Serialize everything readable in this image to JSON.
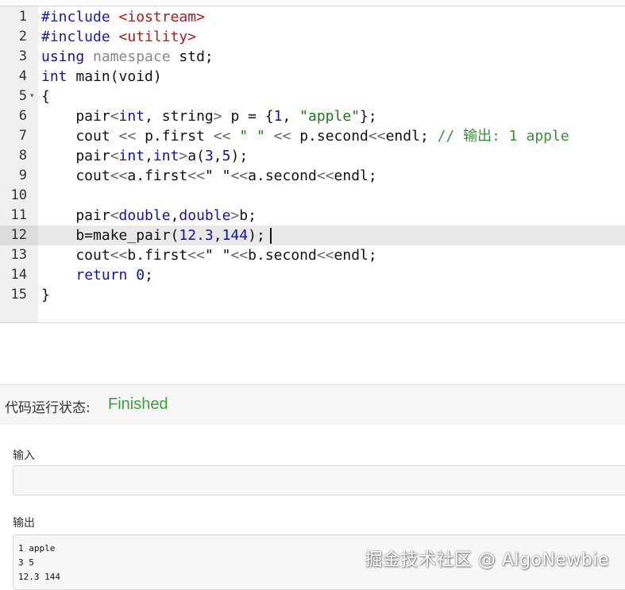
{
  "editor": {
    "line_numbers": [
      "1",
      "2",
      "3",
      "4",
      "5",
      "6",
      "7",
      "8",
      "9",
      "10",
      "11",
      "12",
      "13",
      "14",
      "15"
    ],
    "active_line": "12",
    "code": {
      "l1": {
        "a": "#include ",
        "b": "<iostream>"
      },
      "l2": {
        "a": "#include ",
        "b": "<utility>"
      },
      "l3": {
        "a": "using",
        "b": " ",
        "c": "namespace",
        "d": " std;"
      },
      "l4": {
        "a": "int",
        "b": " main(void)"
      },
      "l5": {
        "a": "{"
      },
      "l6": {
        "a": "    pair",
        "b": "<",
        "c": "int",
        "d": ", string",
        "e": ">",
        "f": " p = {",
        "g": "1",
        "h": ", ",
        "i": "\"apple\"",
        "j": "};"
      },
      "l7": {
        "a": "    cout ",
        "b": "<<",
        "c": " p.first ",
        "d": "<<",
        "e": " ",
        "f": "\" \"",
        "g": " ",
        "h": "<<",
        "i": " p.second",
        "j": "<<",
        "k": "endl; ",
        "l": "// 输出: 1 apple"
      },
      "l8": {
        "a": "    pair",
        "b": "<",
        "c": "int",
        "d": ",",
        "e": "int",
        "f": ">",
        "g": "a(",
        "h": "3",
        "i": ",",
        "j": "5",
        "k": ");"
      },
      "l9": {
        "a": "    cout",
        "b": "<<",
        "c": "a.first",
        "d": "<<",
        "e": "\" \"",
        "f": "<<",
        "g": "a.second",
        "h": "<<",
        "i": "endl;"
      },
      "l10": {
        "a": ""
      },
      "l11": {
        "a": "    pair",
        "b": "<",
        "c": "double",
        "d": ",",
        "e": "double",
        "f": ">",
        "g": "b;"
      },
      "l12": {
        "a": "    b=make_pair(",
        "b": "12.3",
        "c": ",",
        "d": "144",
        "e": ");"
      },
      "l13": {
        "a": "    cout",
        "b": "<<",
        "c": "b.first",
        "d": "<<",
        "e": "\" \"",
        "f": "<<",
        "g": "b.second",
        "h": "<<",
        "i": "endl;"
      },
      "l14": {
        "a": "    ",
        "b": "return",
        "c": " ",
        "d": "0",
        "e": ";"
      },
      "l15": {
        "a": "}"
      }
    },
    "fold_icon": "fold-arrow-icon"
  },
  "status": {
    "label": "代码运行状态:",
    "value": "Finished",
    "value_color": "#3f9e3f"
  },
  "io": {
    "input_label": "输入",
    "input_value": "",
    "output_label": "输出",
    "output_lines": [
      "1 apple",
      "3 5",
      "12.3 144"
    ]
  },
  "watermark": "掘金技术社区 @ AlgoNewbie"
}
